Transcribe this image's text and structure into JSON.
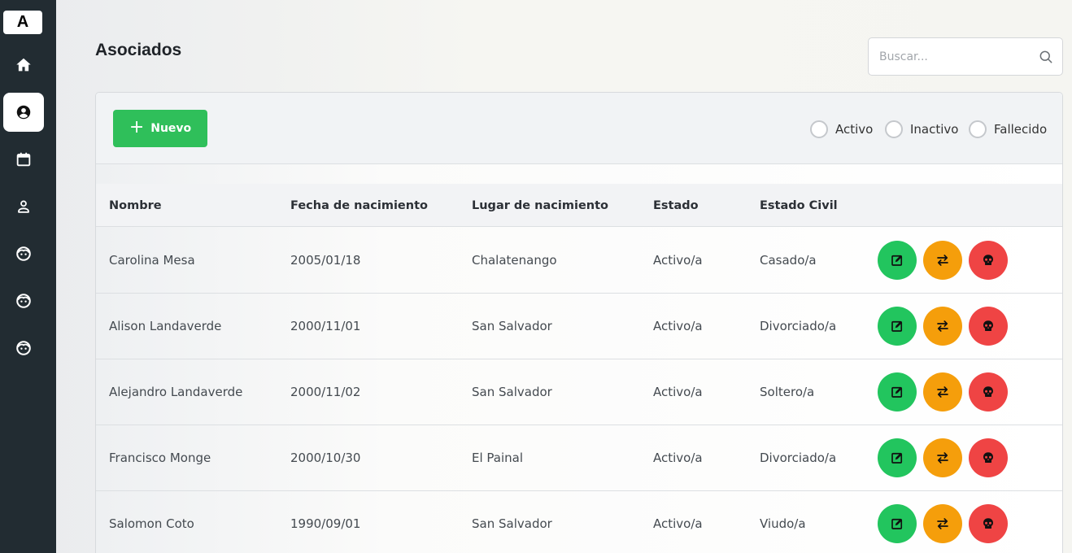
{
  "sidebar": {
    "logo": "A",
    "items": [
      {
        "icon": "home-icon"
      },
      {
        "icon": "user-circle-icon",
        "active": true
      },
      {
        "icon": "calendar-icon"
      },
      {
        "icon": "user-icon"
      },
      {
        "icon": "face-icon"
      },
      {
        "icon": "face-icon"
      },
      {
        "icon": "face-icon"
      }
    ]
  },
  "header": {
    "title": "Asociados",
    "search_placeholder": "Buscar..."
  },
  "toolbar": {
    "new_label": "Nuevo",
    "filters": [
      "Activo",
      "Inactivo",
      "Fallecido"
    ]
  },
  "table": {
    "columns": [
      "Nombre",
      "Fecha de nacimiento",
      "Lugar de nacimiento",
      "Estado",
      "Estado Civil"
    ],
    "rows": [
      [
        "Carolina Mesa",
        "2005/01/18",
        "Chalatenango",
        "Activo/a",
        "Casado/a"
      ],
      [
        "Alison Landaverde",
        "2000/11/01",
        "San Salvador",
        "Activo/a",
        "Divorciado/a"
      ],
      [
        "Alejandro Landaverde",
        "2000/11/02",
        "San Salvador",
        "Activo/a",
        "Soltero/a"
      ],
      [
        "Francisco Monge",
        "2000/10/30",
        "El Painal",
        "Activo/a",
        "Divorciado/a"
      ],
      [
        "Salomon Coto",
        "1990/09/01",
        "San Salvador",
        "Activo/a",
        "Viudo/a"
      ]
    ]
  },
  "colors": {
    "sidebar_bg": "#222c32",
    "new_button": "#2fbf5a",
    "edit_action": "#22c55e",
    "swap_action": "#f59e0b",
    "deceased_action": "#ef4444"
  }
}
